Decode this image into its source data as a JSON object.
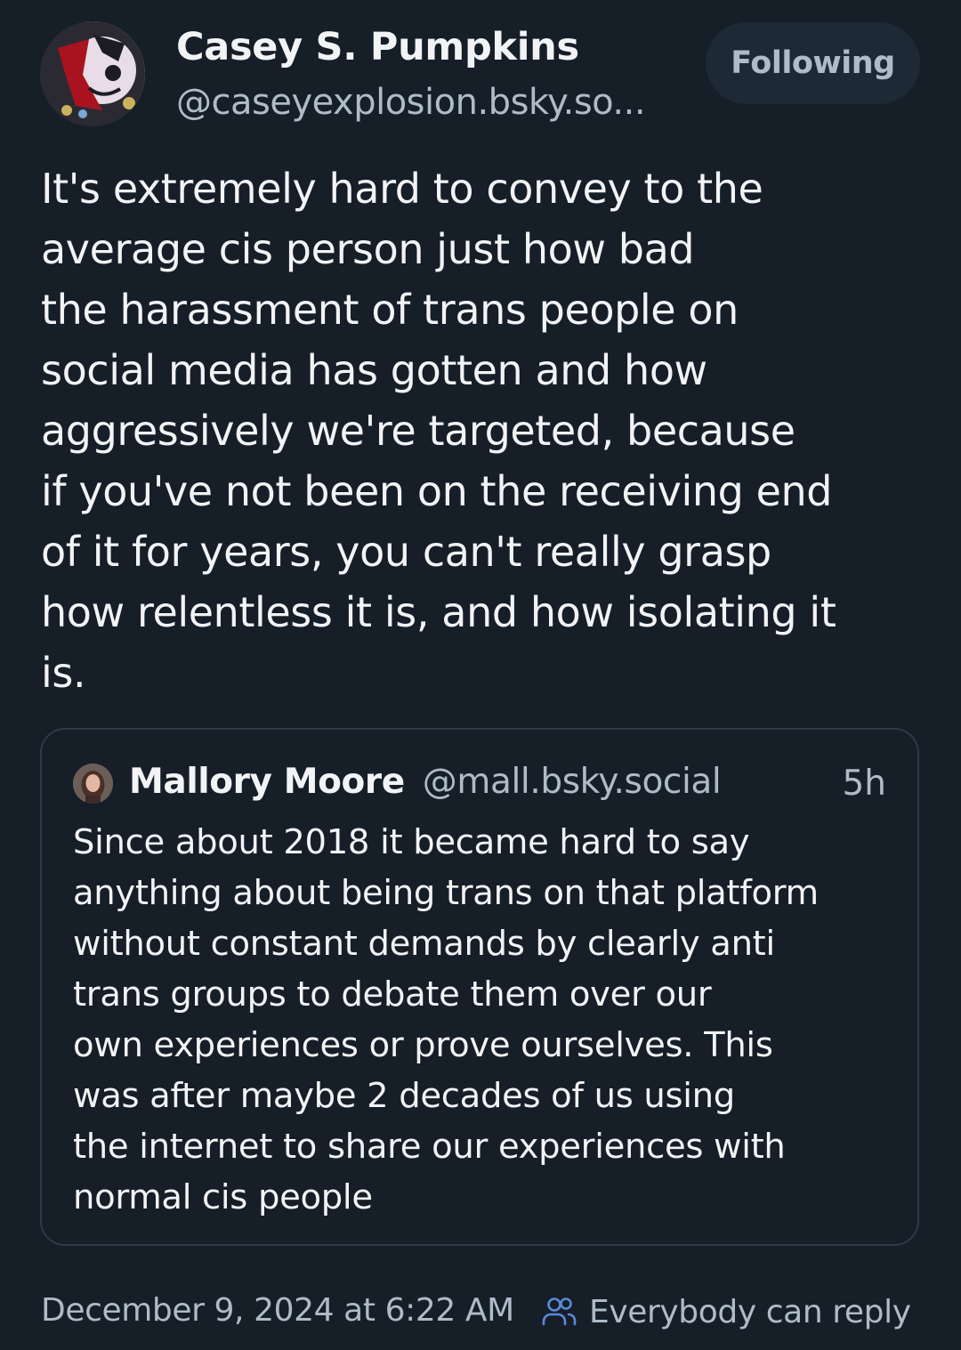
{
  "author": {
    "name": "Casey S. Pumpkins",
    "handle": "@caseyexplosion.bsky.so...",
    "follow_label": "Following"
  },
  "post": {
    "lines": [
      "It's extremely hard to convey to the",
      "average cis person just how bad",
      "the harassment of trans people on",
      "social media has gotten and how",
      "aggressively we're targeted, because",
      "if you've not been on the receiving end",
      "of it for years, you can't really grasp",
      "how relentless it is, and how isolating it",
      "is."
    ]
  },
  "quote": {
    "name": "Mallory Moore",
    "handle": "@mall.bsky.social",
    "time": "5h",
    "lines": [
      "Since about 2018 it became hard to say",
      "anything about being trans on that platform",
      "without constant demands by clearly anti",
      "trans groups to debate them over our",
      "own experiences or prove ourselves. This",
      "was after maybe 2 decades of us using",
      "the internet to share our experiences with",
      "normal cis people"
    ]
  },
  "footer": {
    "date": "December 9, 2024 at 6:22 AM",
    "reply_setting": "Everybody can reply",
    "reply_icon": "people-icon"
  },
  "colors": {
    "background": "#161e27",
    "text": "#f1f3f5",
    "muted": "#aebbc9",
    "button_bg": "#1e2936",
    "border": "#2e3a48"
  }
}
